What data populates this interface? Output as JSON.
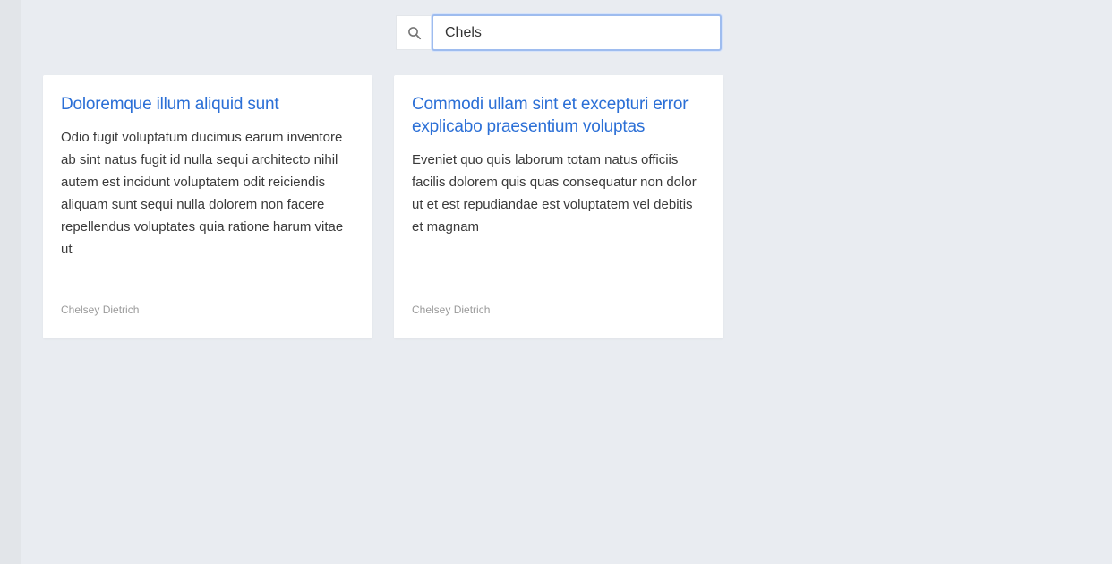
{
  "search": {
    "value": "Chels",
    "icon": "search-icon"
  },
  "cards": [
    {
      "title": "Doloremque illum aliquid sunt",
      "body": "Odio fugit voluptatum ducimus earum inventore ab sint natus fugit id nulla sequi architecto nihil autem est incidunt voluptatem odit reiciendis aliquam sunt sequi nulla dolorem non facere repellendus voluptates quia ratione harum vitae ut",
      "author": "Chelsey Dietrich"
    },
    {
      "title": "Commodi ullam sint et excepturi error explicabo praesentium voluptas",
      "body": "Eveniet quo quis laborum totam natus officiis facilis dolorem quis quas consequatur non dolor ut et est repudiandae est voluptatem vel debitis et magnam",
      "author": "Chelsey Dietrich"
    }
  ],
  "colors": {
    "background": "#e9ecf1",
    "link": "#2b6fd6",
    "focus_border": "#9ebcef"
  }
}
